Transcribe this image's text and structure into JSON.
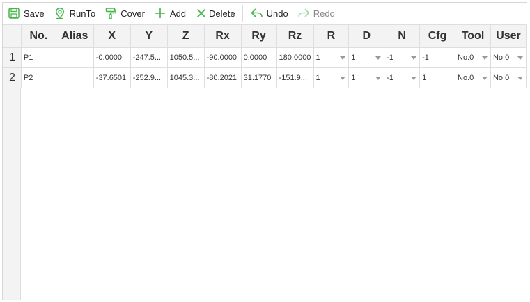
{
  "toolbar": {
    "save": "Save",
    "runto": "RunTo",
    "cover": "Cover",
    "add": "Add",
    "delete": "Delete",
    "undo": "Undo",
    "redo": "Redo"
  },
  "colors": {
    "accent_green": "#44b549",
    "header_bg": "#f3f3f3",
    "grid_line": "#dedede"
  },
  "icons": {
    "save": "save-icon",
    "runto": "location-pin-icon",
    "cover": "paint-roller-icon",
    "add": "plus-icon",
    "delete": "x-icon",
    "undo": "undo-arrow-icon",
    "redo": "redo-arrow-icon"
  },
  "table": {
    "headers": [
      "No.",
      "Alias",
      "X",
      "Y",
      "Z",
      "Rx",
      "Ry",
      "Rz",
      "R",
      "D",
      "N",
      "Cfg",
      "Tool",
      "User"
    ],
    "rows": [
      {
        "row_num": "1",
        "no": "P1",
        "alias": "",
        "x": "-0.0000",
        "y": "-247.5...",
        "z": "1050.5...",
        "rx": "-90.0000",
        "ry": "0.0000",
        "rz": "180.0000",
        "r": "1",
        "d": "1",
        "n": "-1",
        "cfg": "-1",
        "tool": "No.0",
        "user": "No.0"
      },
      {
        "row_num": "2",
        "no": "P2",
        "alias": "",
        "x": "-37.6501",
        "y": "-252.9...",
        "z": "1045.3...",
        "rx": "-80.2021",
        "ry": "31.1770",
        "rz": "-151.9...",
        "r": "1",
        "d": "1",
        "n": "-1",
        "cfg": "1",
        "tool": "No.0",
        "user": "No.0"
      }
    ]
  }
}
